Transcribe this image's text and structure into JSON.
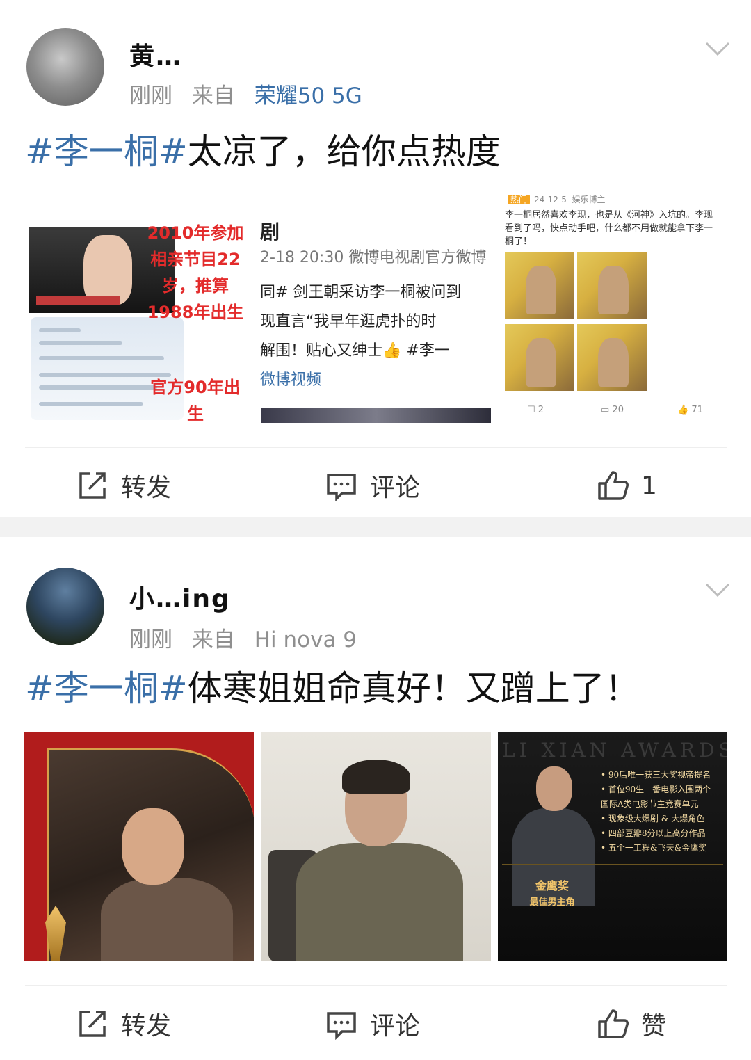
{
  "posts": [
    {
      "username": "黄…",
      "time": "刚刚",
      "source_prefix": "来自",
      "source": "荣耀50 5G",
      "hashtag": "#李一桐#",
      "text": "太凉了，给你点热度",
      "image1": {
        "red_text_1": "2010年参加相亲节目22岁，推算1988年出生",
        "red_text_2": "官方90年出生"
      },
      "image2": {
        "line1": "剧",
        "line2": "2-18 20:30  微博电视剧官方微博",
        "line3": "同# 剑王朝采访李一桐被问到",
        "line4": "现直言“我早年逛虎扑的时",
        "line5": "解围！贴心又绅士👍 #李一",
        "line6": "微博视频"
      },
      "image3": {
        "date": "24-12-5",
        "hot_label": "热门",
        "author_type": "娱乐博主",
        "text": "李一桐居然喜欢李现，也是从《河神》入坑的。李现看到了吗，快点动手吧，什么都不用做就能拿下李一桐了！",
        "reposts": "2",
        "comments": "20",
        "likes": "71"
      },
      "actions": {
        "repost": "转发",
        "comment": "评论",
        "like": "1"
      }
    },
    {
      "username": "小…ing",
      "time": "刚刚",
      "source_prefix": "来自",
      "source": "Hi nova 9",
      "hashtag": "#李一桐#",
      "text": "体寒姐姐命真好！又蹭上了！",
      "image3": {
        "banner": "LI XIAN AWARDS",
        "bullets": [
          "• 90后唯一获三大奖视帝提名",
          "• 首位90生一番电影入围两个",
          "  国际A类电影节主竞赛单元",
          "• 现象级大爆剧 & 大爆角色",
          "• 四部豆瓣8分以上高分作品",
          "• 五个一工程&飞天&金鹰奖"
        ],
        "award": "金鹰奖",
        "award_sub": "最佳男主角"
      },
      "actions": {
        "repost": "转发",
        "comment": "评论",
        "like": "赞"
      }
    }
  ],
  "colors": {
    "link": "#3a6fa8",
    "meta": "#8f8f8f",
    "text": "#111111",
    "band": "#f2f2f2"
  },
  "icons": {
    "chevron": "chevron-down-icon",
    "repost": "repost-icon",
    "comment": "comment-icon",
    "like": "thumbs-up-icon"
  }
}
